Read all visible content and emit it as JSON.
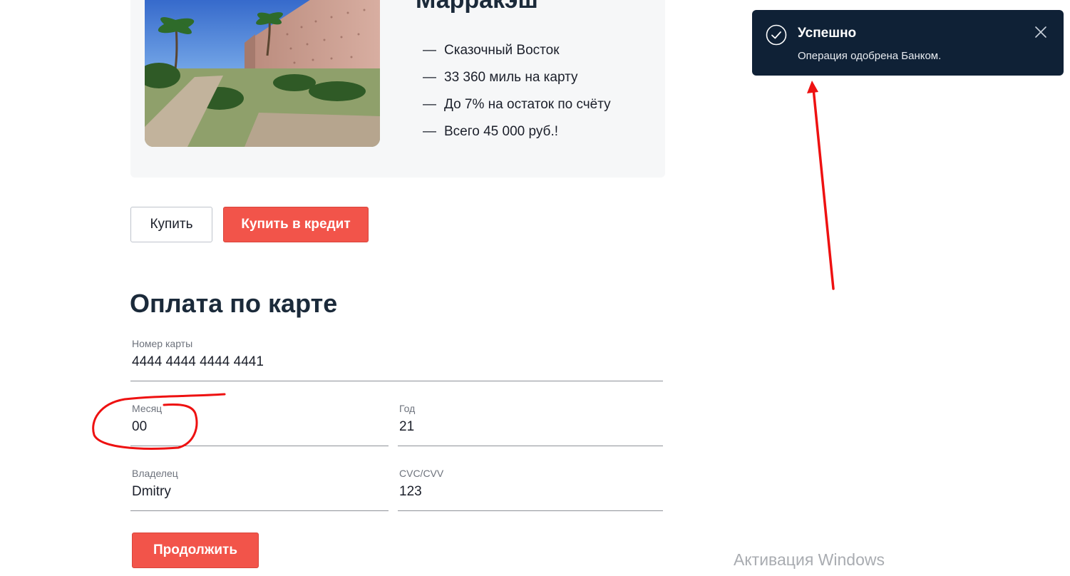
{
  "tour": {
    "city": "Марракэш",
    "features": [
      "Сказочный Восток",
      "33 360 миль на карту",
      "До 7% на остаток по счёту",
      "Всего 45 000 руб.!"
    ],
    "dash": "—"
  },
  "actions": {
    "buy_label": "Купить",
    "credit_label": "Купить в кредит"
  },
  "payment": {
    "title": "Оплата по карте",
    "card_number": {
      "label": "Номер карты",
      "value": "4444 4444 4444 4441"
    },
    "month": {
      "label": "Месяц",
      "value": "00"
    },
    "year": {
      "label": "Год",
      "value": "21"
    },
    "owner": {
      "label": "Владелец",
      "value": "Dmitry"
    },
    "cvc": {
      "label": "CVC/CVV",
      "value": "123"
    },
    "continue_label": "Продолжить"
  },
  "notification": {
    "title": "Успешно",
    "message": "Операция одобрена Банком."
  },
  "os": {
    "watermark": "Активация Windows"
  },
  "colors": {
    "accent": "#f2544a",
    "toast_bg": "#0f2136",
    "annotation": "#ee1111",
    "heading": "#1b2a3a"
  },
  "icons": {
    "toast_status": "check-circle-icon",
    "toast_close": "close-icon"
  }
}
